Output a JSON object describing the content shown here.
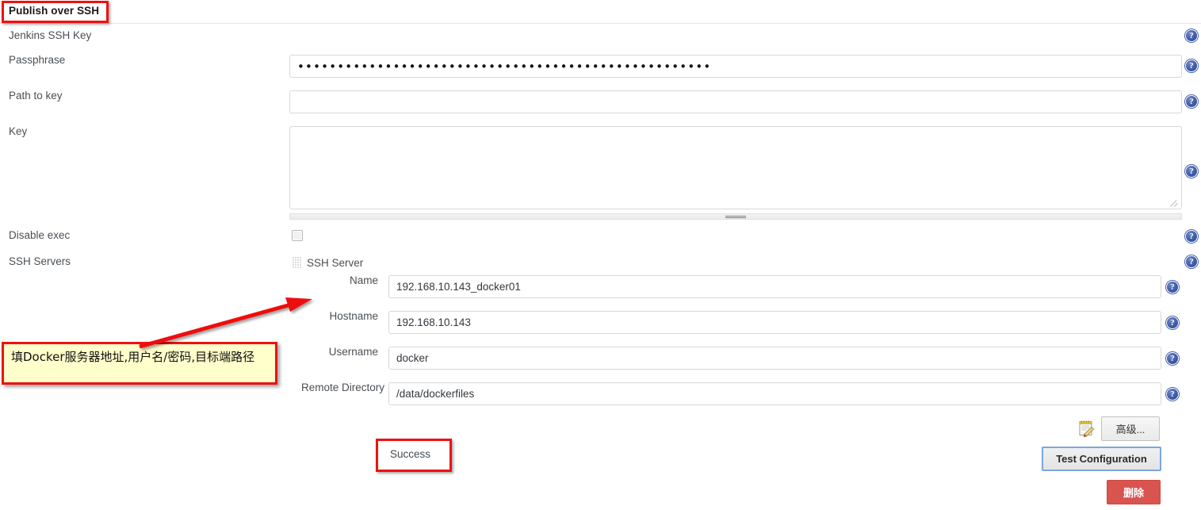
{
  "header": {
    "title": "Publish over SSH"
  },
  "form": {
    "rows": [
      {
        "label": "Jenkins SSH Key"
      },
      {
        "label": "Passphrase"
      },
      {
        "label": "Path to key"
      },
      {
        "label": "Key"
      },
      {
        "label": "Disable exec"
      },
      {
        "label": "SSH Servers"
      }
    ],
    "passphrase_value": "••••••••••••••••••••••••••••••••••••••••••••••••••••",
    "path_to_key_value": "",
    "path_to_key_placeholder": "",
    "key_value": "",
    "key_placeholder": "",
    "disable_exec_checked": false
  },
  "ssh_server": {
    "title": "SSH Server",
    "fields": [
      {
        "label": "Name",
        "value": "192.168.10.143_docker01"
      },
      {
        "label": "Hostname",
        "value": "192.168.10.143"
      },
      {
        "label": "Username",
        "value": "docker"
      },
      {
        "label": "Remote Directory",
        "value": "/data/dockerfiles"
      }
    ]
  },
  "buttons": {
    "advanced": "高级...",
    "test_configuration": "Test Configuration",
    "delete": "删除"
  },
  "status": {
    "test_result": "Success"
  },
  "annotations": {
    "note_text": "填Docker服务器地址,用户名/密码,目标端路径",
    "highlight_color": "#ee1111",
    "note_background": "#ffffcc"
  },
  "icons": {
    "help": "?"
  }
}
